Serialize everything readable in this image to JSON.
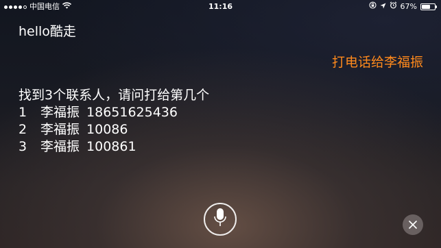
{
  "status_bar": {
    "carrier": "中国电信",
    "time": "11:16",
    "battery_percent_label": "67%",
    "battery_level": 0.67,
    "signal_filled": 4,
    "signal_total": 5
  },
  "conversation": {
    "user_query": "hello酷走",
    "assistant_heard": "打电话给李福振",
    "prompt": "找到3个联系人，请问打给第几个",
    "contacts": [
      {
        "index": "1",
        "name": "李福振",
        "number": "18651625436"
      },
      {
        "index": "2",
        "name": "李福振",
        "number": "10086"
      },
      {
        "index": "3",
        "name": "李福振",
        "number": "100861"
      }
    ]
  },
  "colors": {
    "accent": "#ff8a1c",
    "text": "#ffffff"
  },
  "controls": {
    "mic_icon": "microphone-icon",
    "close_icon": "close-icon"
  }
}
